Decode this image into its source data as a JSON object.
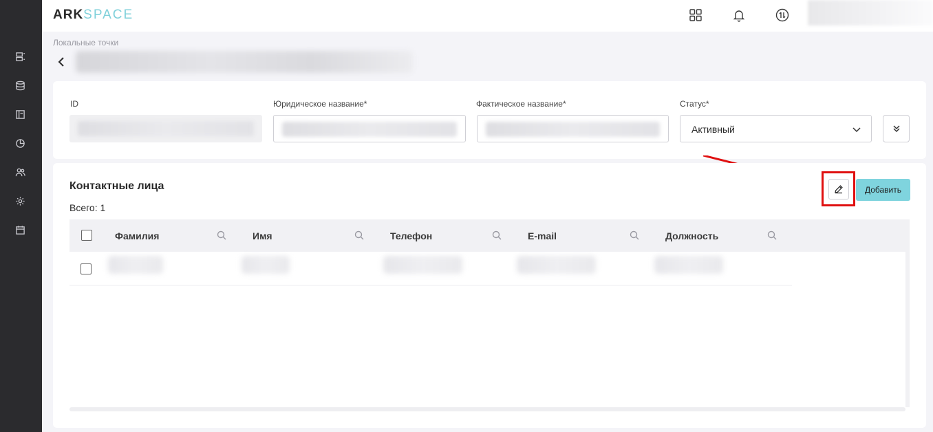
{
  "header": {
    "logo_primary": "ARK",
    "logo_secondary": "SPACE",
    "icons": [
      "apps-grid-icon",
      "bell-icon",
      "exchange-icon"
    ]
  },
  "sidebar": {
    "icons": [
      "layout-list-icon",
      "database-icon",
      "panel-icon",
      "pie-chart-icon",
      "users-icon",
      "gear-icon",
      "calendar-icon"
    ]
  },
  "breadcrumb": "Локальные точки",
  "form": {
    "id_label": "ID",
    "legal_name_label": "Юридическое название*",
    "actual_name_label": "Фактическое название*",
    "status_label": "Статус*",
    "status_value": "Активный"
  },
  "contacts": {
    "title": "Контактные лица",
    "total": "Всего: 1",
    "add_label": "Добавить",
    "columns": [
      "Фамилия",
      "Имя",
      "Телефон",
      "E-mail",
      "Должность"
    ]
  },
  "colors": {
    "accent": "#7fd4de",
    "highlight": "#e01010",
    "sidebar": "#2b2b2e"
  }
}
